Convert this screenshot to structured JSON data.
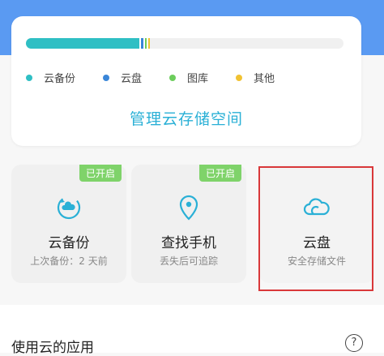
{
  "storage": {
    "bar_fractions": {
      "backup": 0.358,
      "cloud_disk": 0.008,
      "gallery": 0.004,
      "other": 0.004
    },
    "legend": [
      {
        "label": "云备份",
        "color": "#2fbfc4"
      },
      {
        "label": "云盘",
        "color": "#3a86d8"
      },
      {
        "label": "图库",
        "color": "#6ccd5c"
      },
      {
        "label": "其他",
        "color": "#f1c232"
      }
    ],
    "manage_label": "管理云存储空间"
  },
  "features": [
    {
      "title": "云备份",
      "subtitle": "上次备份：2 天前",
      "badge": "已开启",
      "icon": "cloud-sync-icon"
    },
    {
      "title": "查找手机",
      "subtitle": "丢失后可追踪",
      "badge": "已开启",
      "icon": "location-pin-icon"
    },
    {
      "title": "云盘",
      "subtitle": "安全存储文件",
      "badge": "",
      "icon": "cloud-icon"
    }
  ],
  "apps_section": {
    "title": "使用云的应用",
    "help_symbol": "?"
  },
  "colors": {
    "accent": "#2ab0d6",
    "header": "#5a9af2",
    "badge": "#7fd36a",
    "highlight": "#d9383a"
  }
}
